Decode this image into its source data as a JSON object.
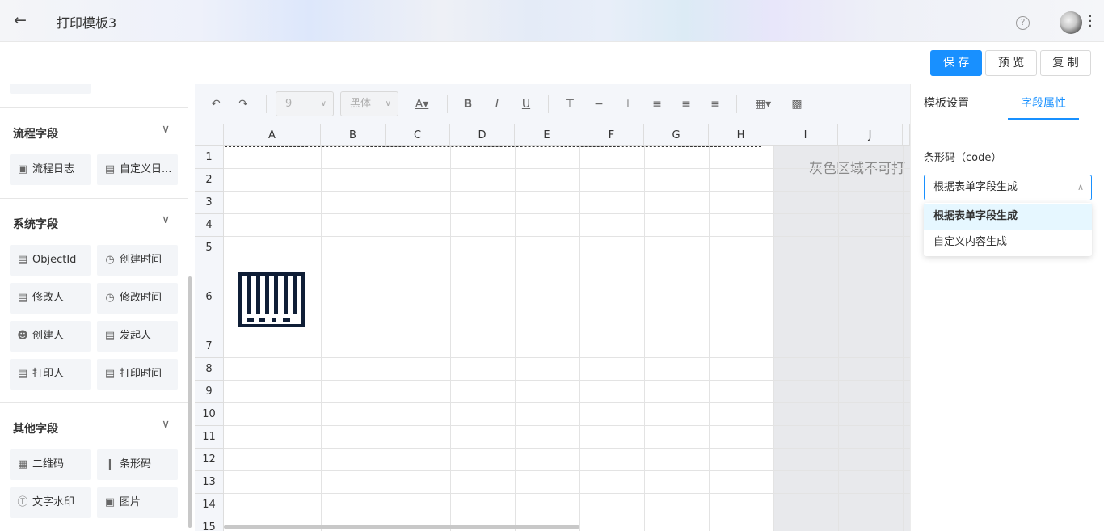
{
  "header": {
    "title": "打印模板3",
    "back_icon": "←",
    "help_icon": "?",
    "more_icon": "⋮"
  },
  "actions": {
    "save": "保 存",
    "preview": "预 览",
    "copy": "复 制"
  },
  "sidebar": {
    "sections": [
      {
        "title": "流程字段",
        "items": [
          {
            "label": "流程日志",
            "icon": "log-icon"
          },
          {
            "label": "自定义日...",
            "icon": "doc-icon"
          }
        ]
      },
      {
        "title": "系统字段",
        "items": [
          {
            "label": "ObjectId",
            "icon": "doc-icon"
          },
          {
            "label": "创建时间",
            "icon": "clock-icon"
          },
          {
            "label": "修改人",
            "icon": "doc-icon"
          },
          {
            "label": "修改时间",
            "icon": "clock-icon"
          },
          {
            "label": "创建人",
            "icon": "user-icon"
          },
          {
            "label": "发起人",
            "icon": "doc-icon"
          },
          {
            "label": "打印人",
            "icon": "doc-icon"
          },
          {
            "label": "打印时间",
            "icon": "doc-icon"
          }
        ]
      },
      {
        "title": "其他字段",
        "items": [
          {
            "label": "二维码",
            "icon": "qrcode-icon"
          },
          {
            "label": "条形码",
            "icon": "barcode-icon"
          },
          {
            "label": "文字水印",
            "icon": "watermark-icon"
          },
          {
            "label": "图片",
            "icon": "image-icon"
          }
        ]
      }
    ]
  },
  "toolbar": {
    "font_size": "9",
    "font_family": "黑体",
    "font_color_label": "A"
  },
  "grid": {
    "columns": [
      "A",
      "B",
      "C",
      "D",
      "E",
      "F",
      "G",
      "H",
      "I",
      "J"
    ],
    "rows": [
      "1",
      "2",
      "3",
      "4",
      "5",
      "6",
      "7",
      "8",
      "9",
      "10",
      "11",
      "12",
      "13",
      "14",
      "15"
    ],
    "gray_area_text": "灰色区域不可打"
  },
  "right_panel": {
    "tabs": [
      "模板设置",
      "字段属性"
    ],
    "active_tab": "字段属性",
    "field_label": "条形码（code）",
    "select_value": "根据表单字段生成",
    "options": [
      "根据表单字段生成",
      "自定义内容生成"
    ],
    "accent_color": "#1890ff"
  }
}
